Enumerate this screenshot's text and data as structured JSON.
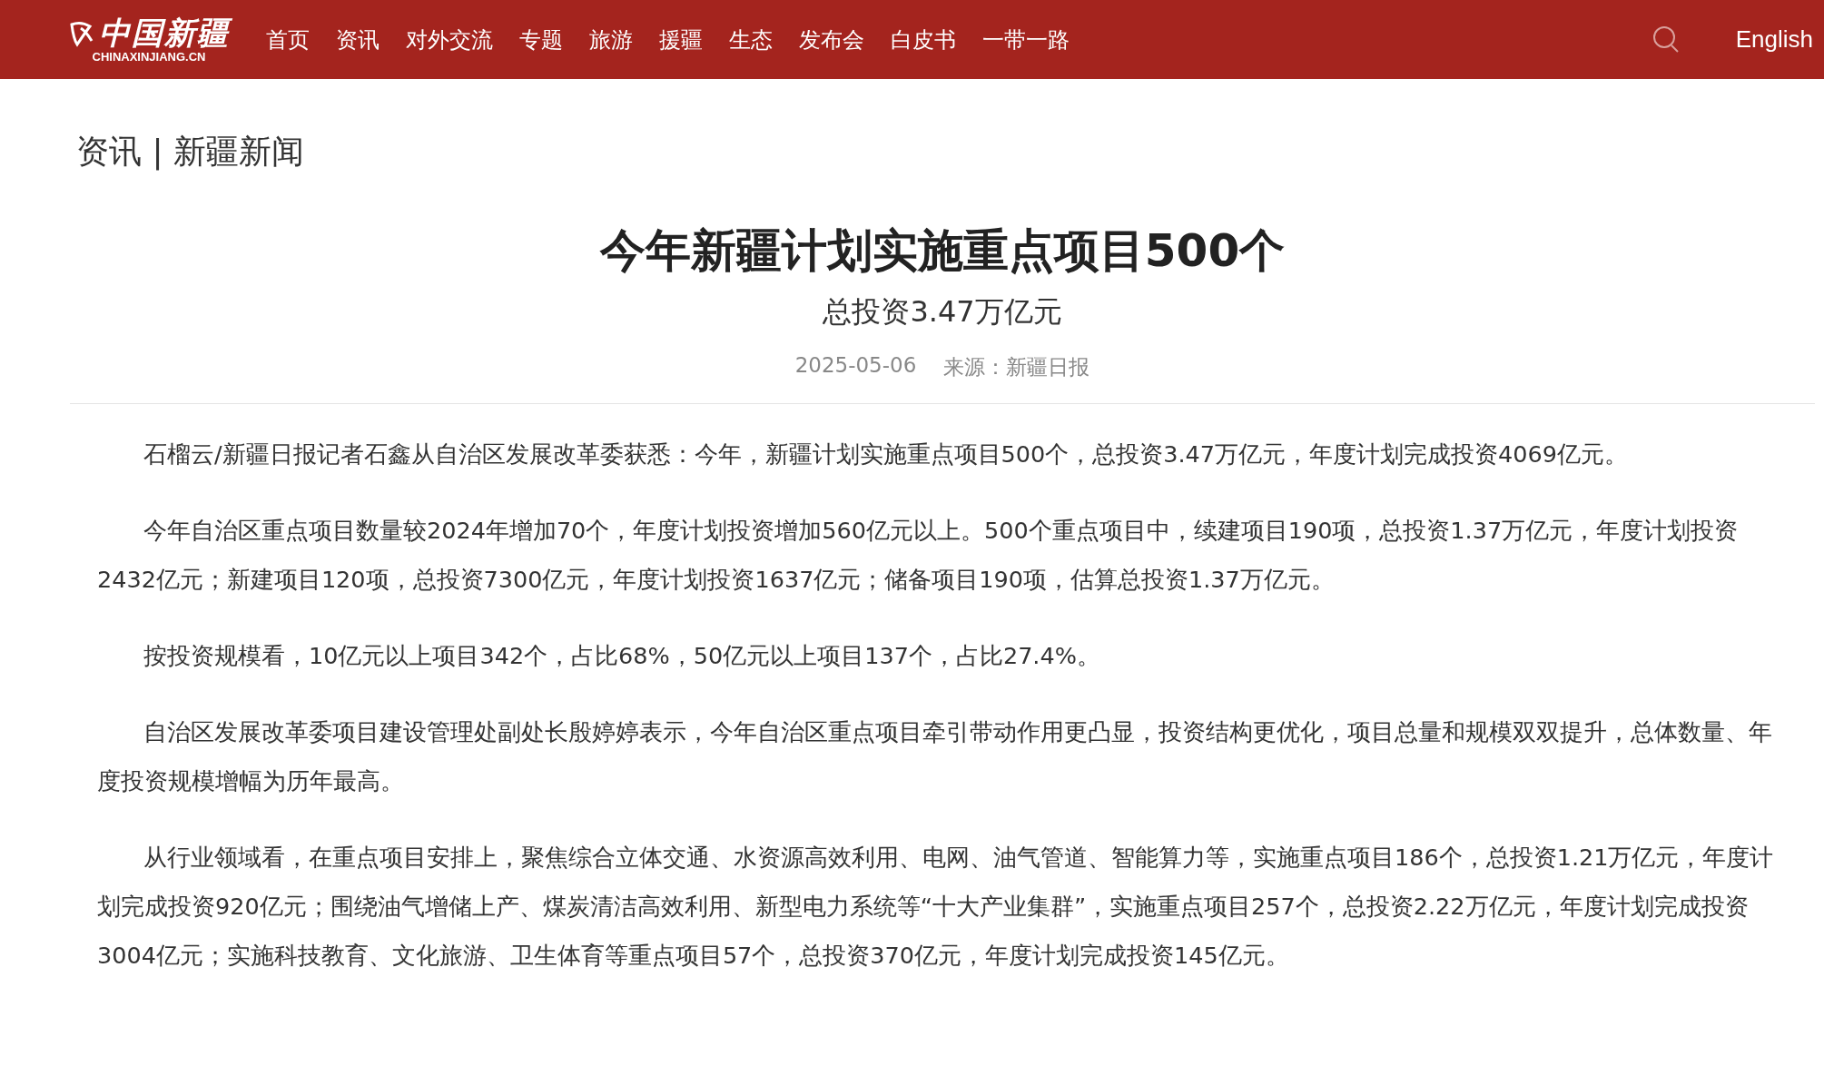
{
  "header": {
    "logo": {
      "title": "中国新疆",
      "subtitle": "CHINAXINJIANG.CN"
    },
    "nav": [
      "首页",
      "资讯",
      "对外交流",
      "专题",
      "旅游",
      "援疆",
      "生态",
      "发布会",
      "白皮书",
      "一带一路"
    ],
    "language": "English"
  },
  "breadcrumb": "资讯 | 新疆新闻",
  "article": {
    "title": "今年新疆计划实施重点项目500个",
    "subtitle": "总投资3.47万亿元",
    "date": "2025-05-06",
    "source": "来源：新疆日报",
    "paragraphs": [
      "石榴云/新疆日报记者石鑫从自治区发展改革委获悉：今年，新疆计划实施重点项目500个，总投资3.47万亿元，年度计划完成投资4069亿元。",
      "今年自治区重点项目数量较2024年增加70个，年度计划投资增加560亿元以上。500个重点项目中，续建项目190项，总投资1.37万亿元，年度计划投资2432亿元；新建项目120项，总投资7300亿元，年度计划投资1637亿元；储备项目190项，估算总投资1.37万亿元。",
      "按投资规模看，10亿元以上项目342个，占比68%，50亿元以上项目137个，占比27.4%。",
      "自治区发展改革委项目建设管理处副处长殷婷婷表示，今年自治区重点项目牵引带动作用更凸显，投资结构更优化，项目总量和规模双双提升，总体数量、年度投资规模增幅为历年最高。",
      "从行业领域看，在重点项目安排上，聚焦综合立体交通、水资源高效利用、电网、油气管道、智能算力等，实施重点项目186个，总投资1.21万亿元，年度计划完成投资920亿元；围绕油气增储上产、煤炭清洁高效利用、新型电力系统等“十大产业集群”，实施重点项目257个，总投资2.22万亿元，年度计划完成投资3004亿元；实施科技教育、文化旅游、卫生体育等重点项目57个，总投资370亿元，年度计划完成投资145亿元。"
    ]
  }
}
